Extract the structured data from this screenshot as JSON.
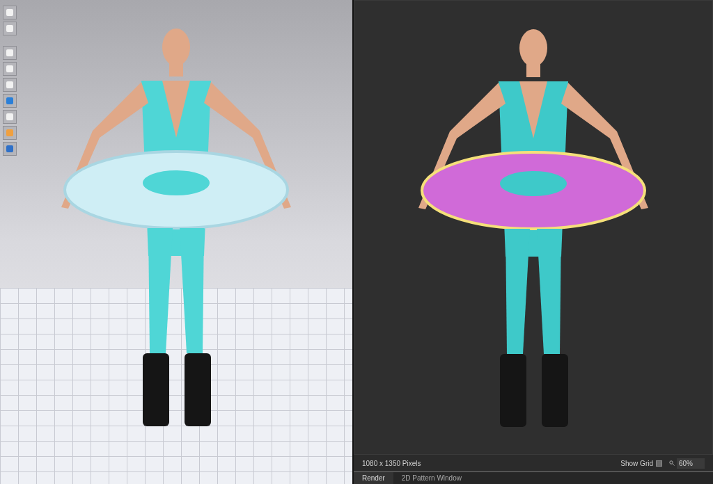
{
  "render_panel": {
    "resolution": "1080 x 1350 Pixels",
    "show_grid": {
      "label": "Show Grid",
      "checked": false
    },
    "zoom": "60%"
  },
  "tabs": [
    {
      "label": "Render",
      "selected": true
    },
    {
      "label": "2D Pattern Window",
      "selected": false
    }
  ]
}
